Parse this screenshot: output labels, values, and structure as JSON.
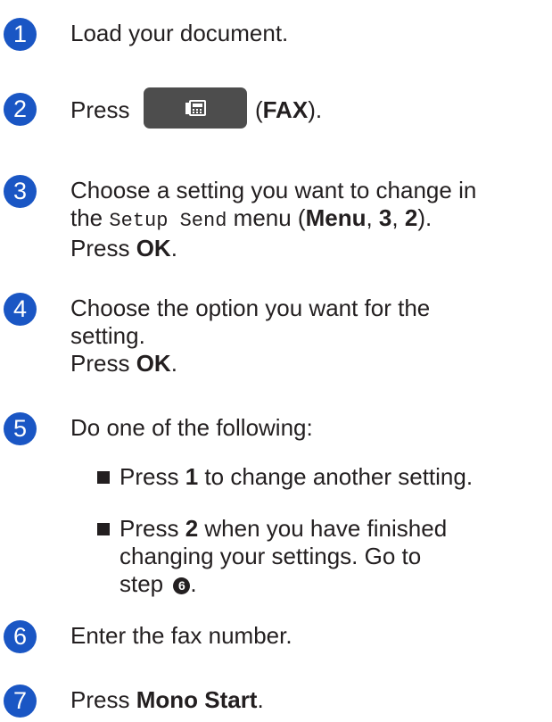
{
  "steps": [
    {
      "num": "1",
      "text": "Load your document."
    },
    {
      "num": "2",
      "prefix": "Press",
      "key_label": "FAX",
      "suffix_open": "(",
      "suffix_close": ")."
    },
    {
      "num": "3",
      "line1": "Choose a setting you want to change in",
      "the": "the",
      "menu_name": "Setup Send",
      "menu_word": "menu (",
      "menu": "Menu",
      "sep1": ", ",
      "n3": "3",
      "sep2": ", ",
      "n2": "2",
      "close": ").",
      "press": "Press",
      "ok": "OK",
      "dot": "."
    },
    {
      "num": "4",
      "line1": "Choose the option you want for the",
      "line2": "setting.",
      "press": "Press",
      "ok": "OK",
      "dot": "."
    },
    {
      "num": "5",
      "text": "Do one of the following:"
    },
    {
      "num": "6",
      "text": "Enter the fax number."
    },
    {
      "num": "7",
      "press": "Press",
      "action": "Mono Start",
      "dot": "."
    }
  ],
  "bullets": [
    {
      "press": "Press",
      "key": "1",
      "rest": "to change another setting."
    },
    {
      "press": "Press",
      "key": "2",
      "rest1": "when you have finished",
      "rest2": "changing your settings. Go to",
      "rest3": "step",
      "step_ref": "6",
      "dot": "."
    }
  ],
  "icons": {
    "fax_key": "fax-icon"
  },
  "colors": {
    "badge": "#1a56c4",
    "key": "#4d4d4d",
    "text": "#231f20"
  }
}
